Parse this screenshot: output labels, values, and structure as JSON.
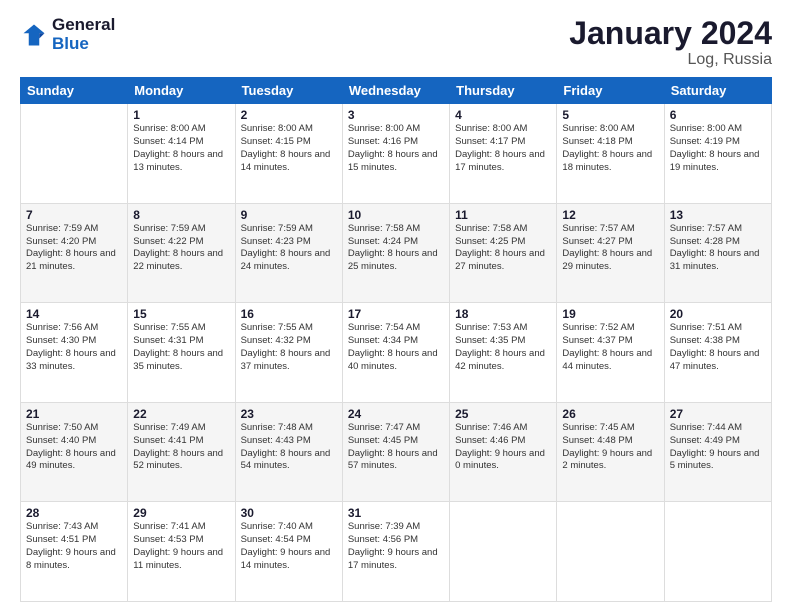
{
  "logo": {
    "line1": "General",
    "line2": "Blue"
  },
  "title": "January 2024",
  "location": "Log, Russia",
  "headers": [
    "Sunday",
    "Monday",
    "Tuesday",
    "Wednesday",
    "Thursday",
    "Friday",
    "Saturday"
  ],
  "weeks": [
    [
      {
        "day": "",
        "sunrise": "",
        "sunset": "",
        "daylight": ""
      },
      {
        "day": "1",
        "sunrise": "Sunrise: 8:00 AM",
        "sunset": "Sunset: 4:14 PM",
        "daylight": "Daylight: 8 hours and 13 minutes."
      },
      {
        "day": "2",
        "sunrise": "Sunrise: 8:00 AM",
        "sunset": "Sunset: 4:15 PM",
        "daylight": "Daylight: 8 hours and 14 minutes."
      },
      {
        "day": "3",
        "sunrise": "Sunrise: 8:00 AM",
        "sunset": "Sunset: 4:16 PM",
        "daylight": "Daylight: 8 hours and 15 minutes."
      },
      {
        "day": "4",
        "sunrise": "Sunrise: 8:00 AM",
        "sunset": "Sunset: 4:17 PM",
        "daylight": "Daylight: 8 hours and 17 minutes."
      },
      {
        "day": "5",
        "sunrise": "Sunrise: 8:00 AM",
        "sunset": "Sunset: 4:18 PM",
        "daylight": "Daylight: 8 hours and 18 minutes."
      },
      {
        "day": "6",
        "sunrise": "Sunrise: 8:00 AM",
        "sunset": "Sunset: 4:19 PM",
        "daylight": "Daylight: 8 hours and 19 minutes."
      }
    ],
    [
      {
        "day": "7",
        "sunrise": "Sunrise: 7:59 AM",
        "sunset": "Sunset: 4:20 PM",
        "daylight": "Daylight: 8 hours and 21 minutes."
      },
      {
        "day": "8",
        "sunrise": "Sunrise: 7:59 AM",
        "sunset": "Sunset: 4:22 PM",
        "daylight": "Daylight: 8 hours and 22 minutes."
      },
      {
        "day": "9",
        "sunrise": "Sunrise: 7:59 AM",
        "sunset": "Sunset: 4:23 PM",
        "daylight": "Daylight: 8 hours and 24 minutes."
      },
      {
        "day": "10",
        "sunrise": "Sunrise: 7:58 AM",
        "sunset": "Sunset: 4:24 PM",
        "daylight": "Daylight: 8 hours and 25 minutes."
      },
      {
        "day": "11",
        "sunrise": "Sunrise: 7:58 AM",
        "sunset": "Sunset: 4:25 PM",
        "daylight": "Daylight: 8 hours and 27 minutes."
      },
      {
        "day": "12",
        "sunrise": "Sunrise: 7:57 AM",
        "sunset": "Sunset: 4:27 PM",
        "daylight": "Daylight: 8 hours and 29 minutes."
      },
      {
        "day": "13",
        "sunrise": "Sunrise: 7:57 AM",
        "sunset": "Sunset: 4:28 PM",
        "daylight": "Daylight: 8 hours and 31 minutes."
      }
    ],
    [
      {
        "day": "14",
        "sunrise": "Sunrise: 7:56 AM",
        "sunset": "Sunset: 4:30 PM",
        "daylight": "Daylight: 8 hours and 33 minutes."
      },
      {
        "day": "15",
        "sunrise": "Sunrise: 7:55 AM",
        "sunset": "Sunset: 4:31 PM",
        "daylight": "Daylight: 8 hours and 35 minutes."
      },
      {
        "day": "16",
        "sunrise": "Sunrise: 7:55 AM",
        "sunset": "Sunset: 4:32 PM",
        "daylight": "Daylight: 8 hours and 37 minutes."
      },
      {
        "day": "17",
        "sunrise": "Sunrise: 7:54 AM",
        "sunset": "Sunset: 4:34 PM",
        "daylight": "Daylight: 8 hours and 40 minutes."
      },
      {
        "day": "18",
        "sunrise": "Sunrise: 7:53 AM",
        "sunset": "Sunset: 4:35 PM",
        "daylight": "Daylight: 8 hours and 42 minutes."
      },
      {
        "day": "19",
        "sunrise": "Sunrise: 7:52 AM",
        "sunset": "Sunset: 4:37 PM",
        "daylight": "Daylight: 8 hours and 44 minutes."
      },
      {
        "day": "20",
        "sunrise": "Sunrise: 7:51 AM",
        "sunset": "Sunset: 4:38 PM",
        "daylight": "Daylight: 8 hours and 47 minutes."
      }
    ],
    [
      {
        "day": "21",
        "sunrise": "Sunrise: 7:50 AM",
        "sunset": "Sunset: 4:40 PM",
        "daylight": "Daylight: 8 hours and 49 minutes."
      },
      {
        "day": "22",
        "sunrise": "Sunrise: 7:49 AM",
        "sunset": "Sunset: 4:41 PM",
        "daylight": "Daylight: 8 hours and 52 minutes."
      },
      {
        "day": "23",
        "sunrise": "Sunrise: 7:48 AM",
        "sunset": "Sunset: 4:43 PM",
        "daylight": "Daylight: 8 hours and 54 minutes."
      },
      {
        "day": "24",
        "sunrise": "Sunrise: 7:47 AM",
        "sunset": "Sunset: 4:45 PM",
        "daylight": "Daylight: 8 hours and 57 minutes."
      },
      {
        "day": "25",
        "sunrise": "Sunrise: 7:46 AM",
        "sunset": "Sunset: 4:46 PM",
        "daylight": "Daylight: 9 hours and 0 minutes."
      },
      {
        "day": "26",
        "sunrise": "Sunrise: 7:45 AM",
        "sunset": "Sunset: 4:48 PM",
        "daylight": "Daylight: 9 hours and 2 minutes."
      },
      {
        "day": "27",
        "sunrise": "Sunrise: 7:44 AM",
        "sunset": "Sunset: 4:49 PM",
        "daylight": "Daylight: 9 hours and 5 minutes."
      }
    ],
    [
      {
        "day": "28",
        "sunrise": "Sunrise: 7:43 AM",
        "sunset": "Sunset: 4:51 PM",
        "daylight": "Daylight: 9 hours and 8 minutes."
      },
      {
        "day": "29",
        "sunrise": "Sunrise: 7:41 AM",
        "sunset": "Sunset: 4:53 PM",
        "daylight": "Daylight: 9 hours and 11 minutes."
      },
      {
        "day": "30",
        "sunrise": "Sunrise: 7:40 AM",
        "sunset": "Sunset: 4:54 PM",
        "daylight": "Daylight: 9 hours and 14 minutes."
      },
      {
        "day": "31",
        "sunrise": "Sunrise: 7:39 AM",
        "sunset": "Sunset: 4:56 PM",
        "daylight": "Daylight: 9 hours and 17 minutes."
      },
      {
        "day": "",
        "sunrise": "",
        "sunset": "",
        "daylight": ""
      },
      {
        "day": "",
        "sunrise": "",
        "sunset": "",
        "daylight": ""
      },
      {
        "day": "",
        "sunrise": "",
        "sunset": "",
        "daylight": ""
      }
    ]
  ]
}
